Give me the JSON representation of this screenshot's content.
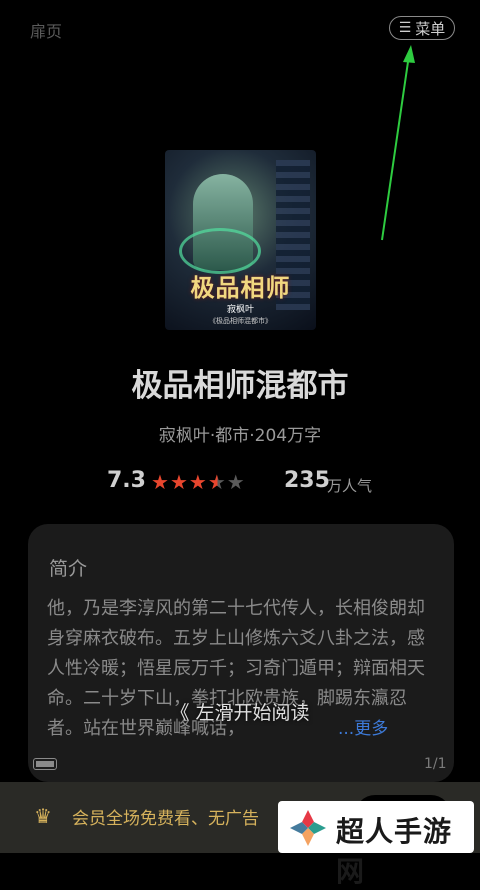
{
  "header": {
    "left_label": "扉页",
    "menu_icon": "hamburger-icon",
    "menu_label": "菜单"
  },
  "cover": {
    "title_text": "极品相师",
    "author_text": "寂枫叶",
    "subtitle_text": "《极品相师混都市》"
  },
  "book": {
    "title": "极品相师混都市",
    "meta": "寂枫叶·都市·204万字",
    "score": "7.3",
    "stars": 3.5,
    "max_stars": 5,
    "star_color": "#e8462e",
    "popularity_value": "235",
    "popularity_unit": "万人气"
  },
  "intro": {
    "heading": "简介",
    "text": "他，乃是李淳风的第二十七代传人，长相俊朗却身穿麻衣破布。五岁上山修炼六爻八卦之法，感人性冷暖；悟星辰万千；习奇门遁甲；辩面相天命。二十岁下山，拳打北欧贵族，脚踢东瀛忍者。站在世界巅峰喊话，",
    "more_label": "...更多"
  },
  "reader": {
    "swipe_hint": "《 左滑开始阅读",
    "page_indicator": "1/1"
  },
  "vip": {
    "icon": "crown-icon",
    "text": "会员全场免费看、无广告",
    "color": "#d6b25c"
  },
  "watermark": {
    "text": "超人手游网"
  },
  "colors": {
    "background": "#000000",
    "card": "#1b1b1b",
    "accent_link": "#3d7ad8",
    "annotation_arrow": "#2ecc40"
  }
}
